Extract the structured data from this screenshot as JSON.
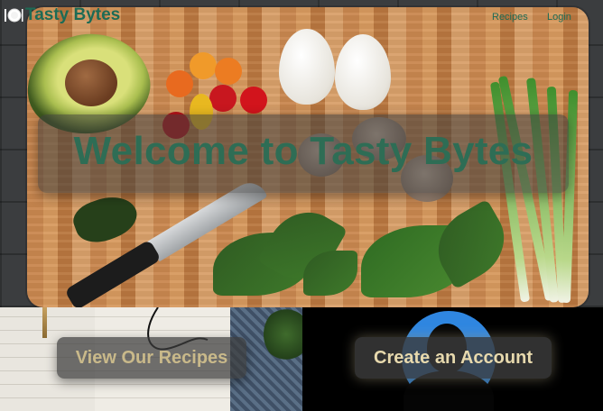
{
  "brand": {
    "name": "Tasty Bytes",
    "icon": "plate-cutlery-icon",
    "color": "#1d6b55"
  },
  "nav": {
    "links": [
      {
        "label": "Recipes"
      },
      {
        "label": "Login"
      }
    ]
  },
  "hero": {
    "headline": "Welcome to Tasty Bytes",
    "headline_color": "#2e6d55"
  },
  "actions": {
    "view_recipes": "View Our Recipes",
    "create_account": "Create an Account",
    "recipes_button_text_color": "#c9b98a",
    "account_button_text_color": "#e7d9ad"
  }
}
